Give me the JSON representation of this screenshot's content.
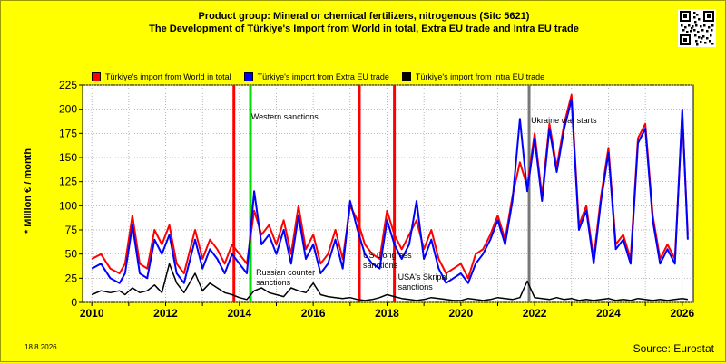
{
  "title_line1": "Product group: Mineral or chemical fertilizers, nitrogenous (Sitc 5621)",
  "title_line2": "The Development of Türkiye's Import from World in total, Extra EU trade and Intra EU trade",
  "date_stamp": "18.8.2026",
  "source": "Source: Eurostat",
  "qr_label": "QR code",
  "chart_data": {
    "type": "line",
    "ylabel": "* Million € / month",
    "ylim": [
      0,
      225
    ],
    "yticks": [
      0,
      25,
      50,
      75,
      100,
      125,
      150,
      175,
      200,
      225
    ],
    "xlim": [
      2009.75,
      2026.3
    ],
    "xticks": [
      2010,
      2012,
      2014,
      2016,
      2018,
      2020,
      2022,
      2024,
      2026
    ],
    "grid": true,
    "legend_position": "top",
    "series": [
      {
        "name": "Türkiye's import from World in total",
        "color": "#ff0000",
        "x": [
          2010.0,
          2010.25,
          2010.5,
          2010.75,
          2010.9,
          2011.1,
          2011.3,
          2011.5,
          2011.7,
          2011.9,
          2012.1,
          2012.3,
          2012.5,
          2012.8,
          2013.0,
          2013.2,
          2013.4,
          2013.6,
          2013.8,
          2014.0,
          2014.2,
          2014.4,
          2014.6,
          2014.8,
          2015.0,
          2015.2,
          2015.4,
          2015.6,
          2015.8,
          2016.0,
          2016.2,
          2016.4,
          2016.6,
          2016.8,
          2017.0,
          2017.2,
          2017.4,
          2017.6,
          2017.8,
          2018.0,
          2018.2,
          2018.4,
          2018.6,
          2018.8,
          2019.0,
          2019.2,
          2019.4,
          2019.6,
          2019.8,
          2020.0,
          2020.2,
          2020.4,
          2020.6,
          2020.8,
          2021.0,
          2021.2,
          2021.4,
          2021.6,
          2021.8,
          2022.0,
          2022.2,
          2022.4,
          2022.6,
          2022.8,
          2023.0,
          2023.2,
          2023.4,
          2023.6,
          2023.8,
          2024.0,
          2024.2,
          2024.4,
          2024.6,
          2024.8,
          2025.0,
          2025.2,
          2025.4,
          2025.6,
          2025.8,
          2026.0,
          2026.15
        ],
        "values": [
          45,
          50,
          35,
          30,
          40,
          90,
          40,
          35,
          75,
          60,
          80,
          40,
          30,
          75,
          45,
          65,
          55,
          40,
          60,
          50,
          40,
          95,
          70,
          80,
          60,
          85,
          50,
          100,
          55,
          70,
          40,
          50,
          75,
          45,
          100,
          85,
          60,
          50,
          45,
          95,
          70,
          55,
          70,
          85,
          55,
          75,
          45,
          30,
          35,
          40,
          25,
          50,
          55,
          70,
          90,
          65,
          110,
          145,
          120,
          175,
          110,
          185,
          140,
          185,
          215,
          80,
          100,
          45,
          110,
          160,
          60,
          70,
          45,
          170,
          185,
          90,
          45,
          60,
          45,
          195,
          70
        ]
      },
      {
        "name": "Türkiye's import from Extra EU trade",
        "color": "#0000ff",
        "x": [
          2010.0,
          2010.25,
          2010.5,
          2010.75,
          2010.9,
          2011.1,
          2011.3,
          2011.5,
          2011.7,
          2011.9,
          2012.1,
          2012.3,
          2012.5,
          2012.8,
          2013.0,
          2013.2,
          2013.4,
          2013.6,
          2013.8,
          2014.0,
          2014.2,
          2014.4,
          2014.6,
          2014.8,
          2015.0,
          2015.2,
          2015.4,
          2015.6,
          2015.8,
          2016.0,
          2016.2,
          2016.4,
          2016.6,
          2016.8,
          2017.0,
          2017.2,
          2017.4,
          2017.6,
          2017.8,
          2018.0,
          2018.2,
          2018.4,
          2018.6,
          2018.8,
          2019.0,
          2019.2,
          2019.4,
          2019.6,
          2019.8,
          2020.0,
          2020.2,
          2020.4,
          2020.6,
          2020.8,
          2021.0,
          2021.2,
          2021.4,
          2021.6,
          2021.8,
          2022.0,
          2022.2,
          2022.4,
          2022.6,
          2022.8,
          2023.0,
          2023.2,
          2023.4,
          2023.6,
          2023.8,
          2024.0,
          2024.2,
          2024.4,
          2024.6,
          2024.8,
          2025.0,
          2025.2,
          2025.4,
          2025.6,
          2025.8,
          2026.0,
          2026.15
        ],
        "values": [
          35,
          40,
          25,
          20,
          30,
          80,
          30,
          25,
          65,
          50,
          70,
          30,
          20,
          65,
          35,
          55,
          45,
          30,
          50,
          40,
          30,
          115,
          60,
          70,
          50,
          75,
          40,
          90,
          45,
          60,
          30,
          40,
          65,
          35,
          105,
          75,
          50,
          40,
          35,
          85,
          60,
          45,
          60,
          105,
          45,
          65,
          35,
          20,
          25,
          30,
          20,
          40,
          50,
          65,
          85,
          60,
          105,
          190,
          115,
          170,
          105,
          180,
          135,
          180,
          210,
          75,
          95,
          40,
          105,
          155,
          55,
          65,
          40,
          165,
          180,
          85,
          40,
          55,
          40,
          200,
          65
        ]
      },
      {
        "name": "Türkiye's import from Intra EU trade",
        "color": "#000000",
        "x": [
          2010.0,
          2010.25,
          2010.5,
          2010.75,
          2010.9,
          2011.1,
          2011.3,
          2011.5,
          2011.7,
          2011.9,
          2012.1,
          2012.3,
          2012.5,
          2012.8,
          2013.0,
          2013.2,
          2013.4,
          2013.6,
          2013.8,
          2014.0,
          2014.2,
          2014.4,
          2014.6,
          2014.8,
          2015.0,
          2015.2,
          2015.4,
          2015.6,
          2015.8,
          2016.0,
          2016.2,
          2016.4,
          2016.6,
          2016.8,
          2017.0,
          2017.2,
          2017.4,
          2017.6,
          2017.8,
          2018.0,
          2018.2,
          2018.4,
          2018.6,
          2018.8,
          2019.0,
          2019.2,
          2019.4,
          2019.6,
          2019.8,
          2020.0,
          2020.2,
          2020.4,
          2020.6,
          2020.8,
          2021.0,
          2021.2,
          2021.4,
          2021.6,
          2021.8,
          2022.0,
          2022.2,
          2022.4,
          2022.6,
          2022.8,
          2023.0,
          2023.2,
          2023.4,
          2023.6,
          2023.8,
          2024.0,
          2024.2,
          2024.4,
          2024.6,
          2024.8,
          2025.0,
          2025.2,
          2025.4,
          2025.6,
          2025.8,
          2026.0,
          2026.15
        ],
        "values": [
          8,
          12,
          10,
          12,
          8,
          15,
          10,
          12,
          18,
          10,
          40,
          20,
          10,
          30,
          12,
          20,
          15,
          10,
          8,
          5,
          3,
          12,
          15,
          10,
          8,
          6,
          15,
          12,
          10,
          20,
          8,
          6,
          5,
          4,
          5,
          3,
          2,
          3,
          5,
          8,
          6,
          4,
          3,
          2,
          3,
          5,
          4,
          3,
          2,
          2,
          4,
          3,
          2,
          3,
          5,
          4,
          3,
          5,
          22,
          5,
          4,
          3,
          5,
          3,
          4,
          2,
          3,
          2,
          3,
          4,
          2,
          3,
          2,
          4,
          3,
          2,
          3,
          2,
          3,
          4,
          3
        ]
      }
    ],
    "events": [
      {
        "x": 2013.85,
        "color": "#ff0000",
        "label": ""
      },
      {
        "x": 2014.3,
        "color": "#00dd00",
        "label": "Western sanctions"
      },
      {
        "x": 2014.3,
        "color": "#00dd00",
        "label": "Russian counter sanctions"
      },
      {
        "x": 2017.25,
        "color": "#ff0000",
        "label": "US Congress sanctions"
      },
      {
        "x": 2018.2,
        "color": "#ff0000",
        "label": "USA's Skripal sanctions"
      },
      {
        "x": 2021.85,
        "color": "#777777",
        "label": "Ukraine war starts"
      }
    ]
  }
}
